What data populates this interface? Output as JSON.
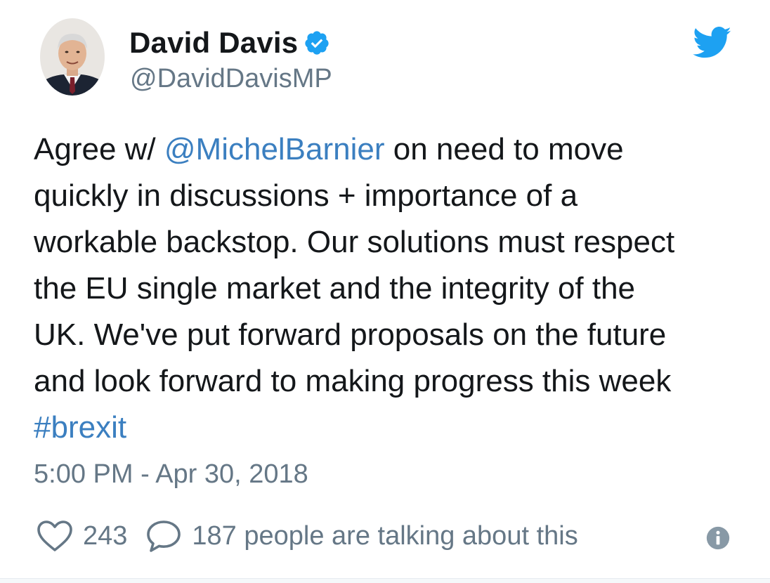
{
  "author": {
    "display_name": "David Davis",
    "handle": "@DavidDavisMP",
    "verified": true,
    "avatar_icon": "profile-photo"
  },
  "tweet": {
    "segments": [
      {
        "type": "text",
        "text": "Agree w/ "
      },
      {
        "type": "mention",
        "text": "@MichelBarnier"
      },
      {
        "type": "text",
        "text": " on need to move"
      }
    ],
    "lines": [
      "quickly in discussions + importance of a",
      "workable backstop. Our solutions must respect",
      "the EU single market and the integrity of the",
      "UK. We've put forward proposals on the future",
      "and look forward to making progress this week"
    ],
    "hashtag": "#brexit",
    "timestamp": "5:00 PM - Apr 30, 2018"
  },
  "actions": {
    "likes_icon": "heart-icon",
    "likes_count": "243",
    "replies_icon": "speech-bubble-icon",
    "replies_text": "187 people are talking about this",
    "info_icon": "info-icon"
  },
  "colors": {
    "text": "#14171a",
    "secondary": "#657786",
    "link": "#3b7fc0",
    "twitter_blue": "#1da1f2"
  }
}
